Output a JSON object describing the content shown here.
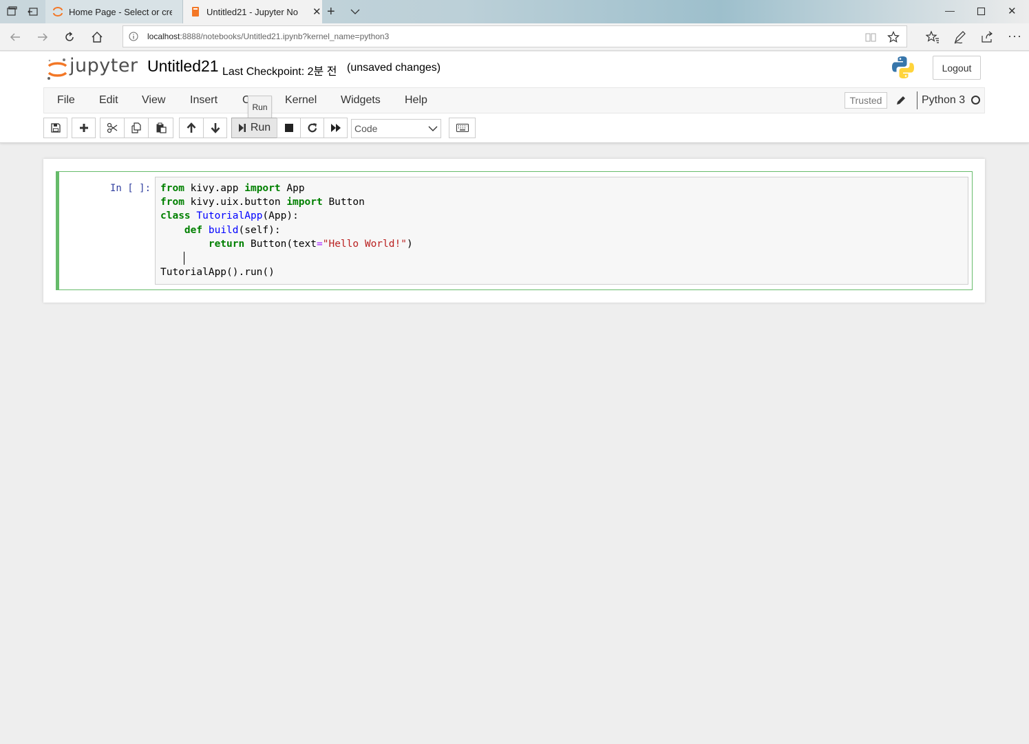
{
  "browser": {
    "tabs": [
      {
        "title": "Home Page - Select or creat",
        "active": false
      },
      {
        "title": "Untitled21 - Jupyter No",
        "active": true
      }
    ],
    "url_host": "localhost",
    "url_rest": ":8888/notebooks/Untitled21.ipynb?kernel_name=python3"
  },
  "header": {
    "logo_text": "jupyter",
    "notebook_title": "Untitled21",
    "checkpoint": "Last Checkpoint: 2분 전",
    "unsaved": "(unsaved changes)",
    "logout_label": "Logout"
  },
  "menu": {
    "items": [
      "File",
      "Edit",
      "View",
      "Insert",
      "C",
      "Kernel",
      "Widgets",
      "Help"
    ],
    "trusted_label": "Trusted",
    "kernel_name": "Python 3"
  },
  "tooltip": "Run",
  "toolbar": {
    "run_label": "Run",
    "cell_type": "Code"
  },
  "cell": {
    "prompt": "In [ ]:",
    "code": {
      "line1": {
        "k1": "from",
        "t1": " kivy.app ",
        "k2": "import",
        "t2": " App"
      },
      "line2": {
        "k1": "from",
        "t1": " kivy.uix.button ",
        "k2": "import",
        "t2": " Button"
      },
      "line3": {
        "k1": "class",
        "sp": " ",
        "name": "TutorialApp",
        "t1": "(App):"
      },
      "line4": {
        "indent": "    ",
        "k1": "def",
        "sp": " ",
        "name": "build",
        "t1": "(self):"
      },
      "line5": {
        "indent": "        ",
        "k1": "return",
        "t1": " Button(text",
        "op": "=",
        "str": "\"Hello World!\"",
        "t2": ")"
      },
      "line7": "TutorialApp().run()"
    }
  },
  "colors": {
    "cell_border": "#66bb6a",
    "keyword": "#008000",
    "definition": "#0000ff",
    "string": "#ba2121",
    "prompt": "#303f9f",
    "logo_orange": "#f37726"
  }
}
